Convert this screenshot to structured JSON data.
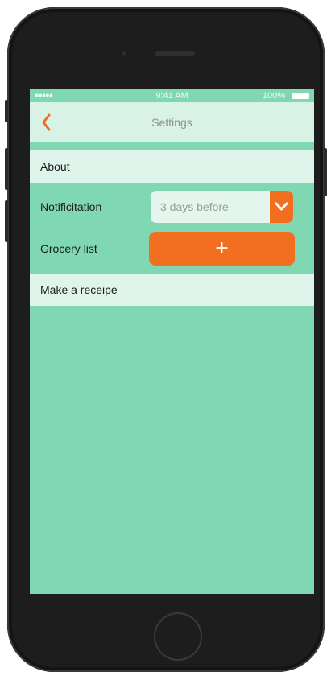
{
  "status_bar": {
    "signal": "●●●●● ",
    "time": "9:41 AM",
    "battery": "100%"
  },
  "nav": {
    "title": "Settings",
    "back_icon": "chevron-left-icon"
  },
  "settings": {
    "about_label": "About",
    "notification_label": "Notificitation",
    "notification_value": "3 days before",
    "dropdown_icon": "chevron-down-icon",
    "grocery_label": "Grocery list",
    "grocery_button": "+",
    "recipe_label": "Make a receipe"
  },
  "colors": {
    "accent": "#f26f22",
    "background": "#80d8b2",
    "row": "#dff5eb"
  }
}
